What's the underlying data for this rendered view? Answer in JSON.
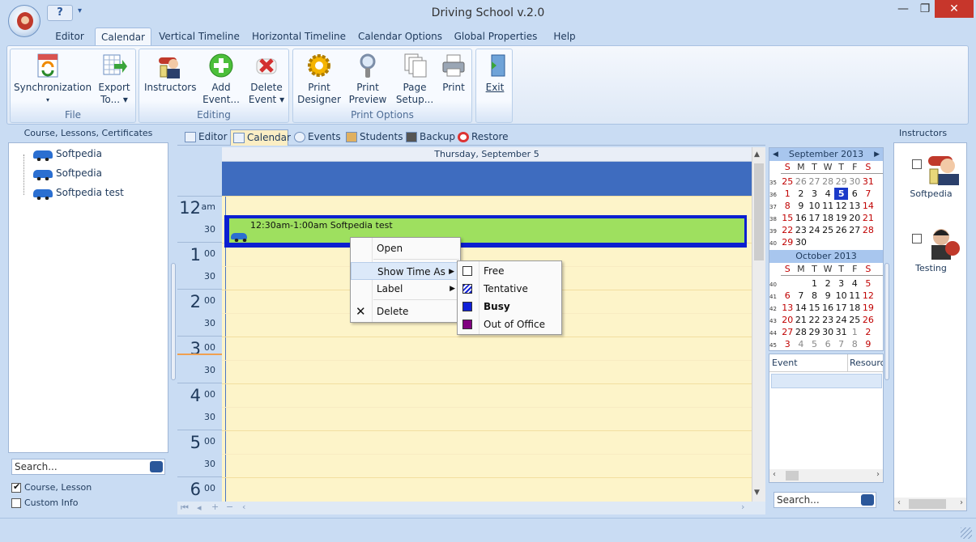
{
  "window": {
    "title": "Driving School v.2.0",
    "minimize": "—",
    "restore": "❐",
    "close": "✕"
  },
  "qat": {
    "help": "?",
    "dropdown": "▾"
  },
  "ribbon_tabs": [
    "Editor",
    "Calendar",
    "Vertical Timeline",
    "Horizontal Timeline",
    "Calendar Options",
    "Global Properties",
    "Help"
  ],
  "ribbon": {
    "file": {
      "label": "File",
      "sync": "Synchronization",
      "export1": "Export",
      "export2": "To..."
    },
    "editing": {
      "label": "Editing",
      "instructors": "Instructors",
      "add1": "Add",
      "add2": "Event...",
      "del1": "Delete",
      "del2": "Event"
    },
    "print": {
      "label": "Print Options",
      "pd1": "Print",
      "pd2": "Designer",
      "pp1": "Print",
      "pp2": "Preview",
      "ps1": "Page",
      "ps2": "Setup...",
      "print": "Print"
    },
    "exit": {
      "label": "Exit"
    }
  },
  "left": {
    "title": "Course, Lessons, Certificates",
    "items": [
      "Softpedia",
      "Softpedia",
      "Softpedia test"
    ],
    "search": "Search...",
    "opt1": "Course, Lesson",
    "opt2": "Custom Info"
  },
  "view_tabs": [
    "Editor",
    "Calendar",
    "Events",
    "Students",
    "Backup",
    "Restore"
  ],
  "day": {
    "header": "Thursday, September 5",
    "hours": [
      {
        "h": "12",
        "s": "am",
        "half": "30"
      },
      {
        "h": "1",
        "s": "00",
        "half": "30"
      },
      {
        "h": "2",
        "s": "00",
        "half": "30"
      },
      {
        "h": "3",
        "s": "00",
        "half": "30"
      },
      {
        "h": "4",
        "s": "00",
        "half": "30"
      },
      {
        "h": "5",
        "s": "00",
        "half": "30"
      },
      {
        "h": "6",
        "s": "00",
        "half": ""
      }
    ],
    "appointment": "12:30am-1:00am Softpedia test"
  },
  "context_menu": {
    "open": "Open",
    "show_time_as": "Show Time As",
    "label": "Label",
    "delete": "Delete"
  },
  "submenu": {
    "free": "Free",
    "tentative": "Tentative",
    "busy": "Busy",
    "out": "Out of Office"
  },
  "colors": {
    "busy": "#1020d8",
    "out_of_office": "#800080",
    "appointment": "#9ee05f"
  },
  "calendar": {
    "dows": [
      "S",
      "M",
      "T",
      "W",
      "T",
      "F",
      "S"
    ],
    "sep_title": "September 2013",
    "oct_title": "October 2013",
    "sep": [
      {
        "w": "35",
        "d": [
          "25",
          "26",
          "27",
          "28",
          "29",
          "30",
          "31"
        ]
      },
      {
        "w": "36",
        "d": [
          "1",
          "2",
          "3",
          "4",
          "5",
          "6",
          "7"
        ]
      },
      {
        "w": "37",
        "d": [
          "8",
          "9",
          "10",
          "11",
          "12",
          "13",
          "14"
        ]
      },
      {
        "w": "38",
        "d": [
          "15",
          "16",
          "17",
          "18",
          "19",
          "20",
          "21"
        ]
      },
      {
        "w": "39",
        "d": [
          "22",
          "23",
          "24",
          "25",
          "26",
          "27",
          "28"
        ]
      },
      {
        "w": "40",
        "d": [
          "29",
          "30",
          "",
          "",
          "",
          "",
          ""
        ]
      }
    ],
    "oct": [
      {
        "w": "40",
        "d": [
          "",
          "",
          "1",
          "2",
          "3",
          "4",
          "5"
        ]
      },
      {
        "w": "41",
        "d": [
          "6",
          "7",
          "8",
          "9",
          "10",
          "11",
          "12"
        ]
      },
      {
        "w": "42",
        "d": [
          "13",
          "14",
          "15",
          "16",
          "17",
          "18",
          "19"
        ]
      },
      {
        "w": "43",
        "d": [
          "20",
          "21",
          "22",
          "23",
          "24",
          "25",
          "26"
        ]
      },
      {
        "w": "44",
        "d": [
          "27",
          "28",
          "29",
          "30",
          "31",
          "1",
          "2"
        ]
      },
      {
        "w": "45",
        "d": [
          "3",
          "4",
          "5",
          "6",
          "7",
          "8",
          "9"
        ]
      }
    ]
  },
  "events_table": {
    "col1": "Event",
    "col2": "Resource",
    "search": "Search..."
  },
  "instructors": {
    "title": "Instructors",
    "people": [
      "Softpedia",
      "Testing"
    ]
  }
}
